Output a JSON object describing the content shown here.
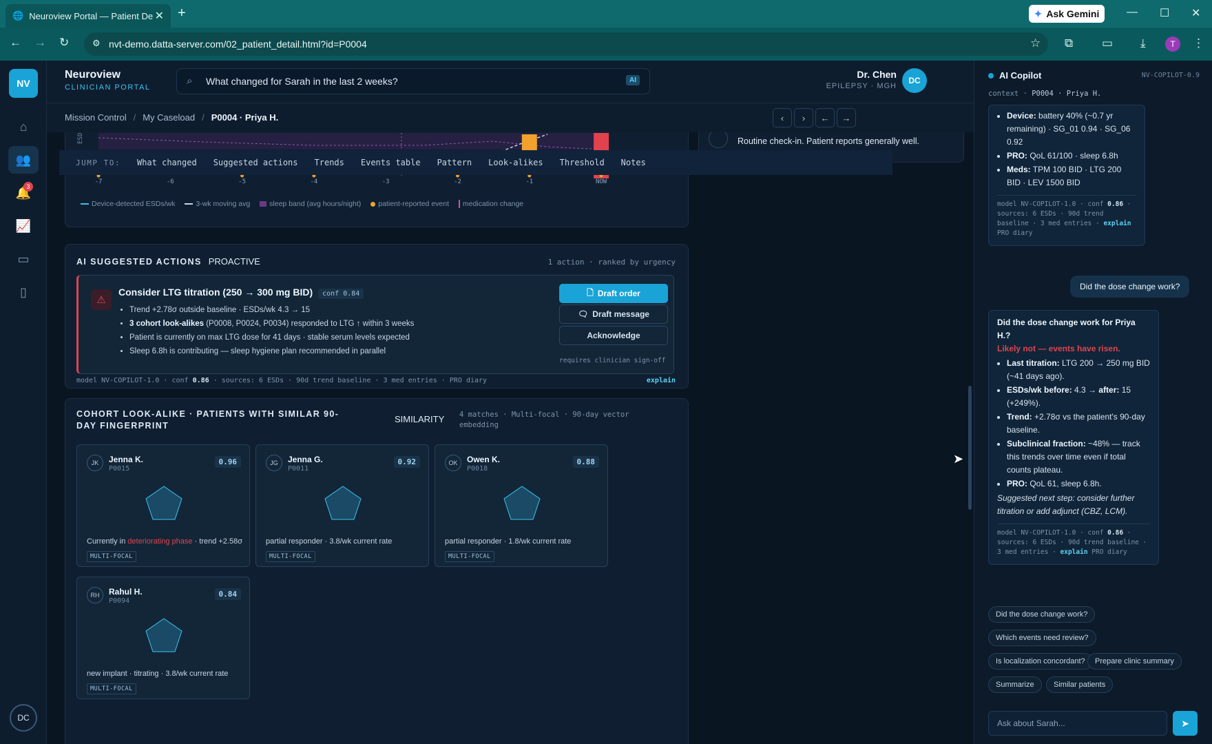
{
  "browser": {
    "tab_title": "Neuroview Portal — Patient De",
    "url": "nvt-demo.datta-server.com/02_patient_detail.html?id=P0004",
    "gemini_label": "Ask Gemini",
    "profile_initial": "T"
  },
  "rail": {
    "logo": "NV",
    "alert_count": "3",
    "avatar": "DC"
  },
  "header": {
    "brand": "Neuroview",
    "brand_sub": "CLINICIAN PORTAL",
    "search_value": "What changed for Sarah in the last 2 weeks?",
    "search_badge": "AI",
    "doctor_name": "Dr. Chen",
    "doctor_sub": "EPILEPSY · MGH",
    "doctor_initials": "DC"
  },
  "breadcrumb": {
    "items": [
      "Mission Control",
      "My Caseload",
      "P0004 · Priya H."
    ]
  },
  "chart_data": {
    "type": "bar",
    "categories": [
      "-7",
      "-6",
      "-5",
      "-4",
      "-3",
      "-2",
      "-1",
      "NOW"
    ],
    "ylabel": "ESDs",
    "legend": [
      "Device-detected ESDs/wk",
      "3-wk moving avg",
      "sleep band (avg hours/night)",
      "patient-reported event",
      "medication change"
    ]
  },
  "checkin_text": "Routine check-in. Patient reports generally well.",
  "jump": {
    "label": "JUMP TO:",
    "items": [
      "What changed",
      "Suggested actions",
      "Trends",
      "Events table",
      "Pattern",
      "Look-alikes",
      "Threshold",
      "Notes"
    ]
  },
  "actions": {
    "title": "AI SUGGESTED ACTIONS",
    "tag": "PROACTIVE",
    "meta": "1 action · ranked by urgency",
    "card_title": "Consider LTG titration (250 → 300 mg BID)",
    "card_conf": "conf 0.84",
    "bullets": [
      "Trend +2.78σ outside baseline · ESDs/wk 4.3 → 15",
      "3 cohort look-alikes",
      " (P0008, P0024, P0034) responded to LTG ↑ within 3 weeks",
      "Patient is currently on max LTG dose for 41 days · stable serum levels expected",
      "Sleep 6.8h is contributing — sleep hygiene plan recommended in parallel"
    ],
    "btn_draft_order": "Draft order",
    "btn_draft_message": "Draft message",
    "btn_ack": "Acknowledge",
    "signoff": "requires clinician sign-off",
    "model_prefix": "model NV-COPILOT-1.0 · conf ",
    "model_conf": "0.86",
    "model_sources": " · sources: 6 ESDs · 90d trend baseline · 3 med entries · PRO diary",
    "explain": "explain"
  },
  "cohort": {
    "title": "COHORT LOOK-ALIKE · PATIENTS WITH SIMILAR 90-DAY FINGERPRINT",
    "tag": "SIMILARITY",
    "meta": "4 matches · Multi-focal · 90-day vector embedding",
    "patients": [
      {
        "initials": "JK",
        "name": "Jenna K.",
        "id": "P0015",
        "score": "0.96",
        "desc_a": "Currently in ",
        "desc_bad": "deteriorating phase",
        "desc_b": " · trend +2.58σ",
        "tag": "MULTI-FOCAL"
      },
      {
        "initials": "JG",
        "name": "Jenna G.",
        "id": "P0011",
        "score": "0.92",
        "desc_a": "partial responder · 3.8/wk current rate",
        "desc_bad": "",
        "desc_b": "",
        "tag": "MULTI-FOCAL"
      },
      {
        "initials": "OK",
        "name": "Owen K.",
        "id": "P0018",
        "score": "0.88",
        "desc_a": "partial responder · 1.8/wk current rate",
        "desc_bad": "",
        "desc_b": "",
        "tag": "MULTI-FOCAL"
      },
      {
        "initials": "RH",
        "name": "Rahul H.",
        "id": "P0094",
        "score": "0.84",
        "desc_a": "new implant · titrating · 3.8/wk current rate",
        "desc_bad": "",
        "desc_b": "",
        "tag": "MULTI-FOCAL"
      }
    ]
  },
  "copilot": {
    "title": "AI Copilot",
    "version": "NV-COPILOT-0.9",
    "context_prefix": "context · ",
    "context_value": "P0004 · Priya H.",
    "msg1": {
      "l1b": "Device:",
      "l1": " battery 40% (~0.7 yr remaining) · SG_01 0.94 · SG_06 0.92",
      "l2b": "PRO:",
      "l2": " QoL 61/100 · sleep 6.8h",
      "l3b": "Meds:",
      "l3": " TPM 100 BID · LTG 200 BID · LEV 1500 BID",
      "meta_a": "model NV-COPILOT-1.0 · conf ",
      "meta_conf": "0.86",
      "meta_b": " · sources: 6 ESDs · 90d trend baseline · 3 med entries · ",
      "meta_c": " PRO diary",
      "explain": "explain"
    },
    "user_q": "Did the dose change work?",
    "msg2": {
      "title": "Did the dose change work for Priya H.?",
      "alert": "Likely not — events have risen.",
      "b1b": "Last titration:",
      "b1": " LTG 200 → 250 mg BID (~41 days ago).",
      "b2b": "ESDs/wk before:",
      "b2m": " 4.3 → ",
      "b2b2": "after:",
      "b2": " 15 (+249%).",
      "b3b": "Trend:",
      "b3": " +2.78σ vs the patient's 90-day baseline.",
      "b4b": "Subclinical fraction:",
      "b4": " ~48% — track this trends over time even if total counts plateau.",
      "b5b": "PRO:",
      "b5": " QoL 61, sleep 6.8h.",
      "next": "Suggested next step: consider further titration or add adjunct (CBZ, LCM).",
      "meta_a": "model NV-COPILOT-1.0 · conf ",
      "meta_conf": "0.86",
      "meta_b": " · sources: 6 ESDs · 90d trend baseline · 3 med entries · ",
      "meta_c": " PRO diary",
      "explain": "explain"
    },
    "chips": [
      "Did the dose change work?",
      "Which events need review?",
      "Is localization concordant?",
      "Prepare clinic summary",
      "Summarize",
      "Similar patients"
    ],
    "input_placeholder": "Ask about Sarah..."
  }
}
